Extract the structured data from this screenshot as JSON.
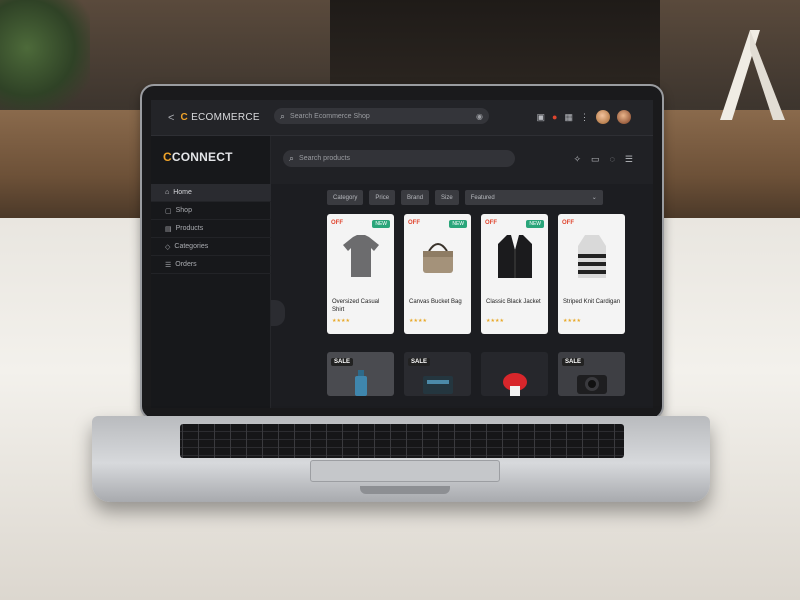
{
  "colors": {
    "accent": "#f0a329",
    "sale_red": "#e0452e",
    "badge_green": "#2aa57a",
    "star": "#e8a92a"
  },
  "topbar": {
    "back_label": "<",
    "logo_letter": "C",
    "logo_text": "ECOMMERCE",
    "search_placeholder": "Search Ecommerce Shop",
    "icons": [
      "calendar-icon",
      "notification-icon",
      "cart-icon",
      "more-icon",
      "avatar",
      "avatar-2"
    ]
  },
  "sidebar": {
    "brand_letter": "C",
    "brand_text": "CONNECT",
    "items": [
      {
        "label": "Home",
        "icon": "home-icon"
      },
      {
        "label": "Shop",
        "icon": "shop-icon"
      },
      {
        "label": "Products",
        "icon": "products-icon"
      },
      {
        "label": "Categories",
        "icon": "categories-icon"
      },
      {
        "label": "Orders",
        "icon": "orders-icon"
      }
    ]
  },
  "secbar": {
    "search_placeholder": "Search products",
    "icons": [
      "sparkle-icon",
      "chat-icon",
      "settings-icon",
      "menu-icon"
    ]
  },
  "filters": {
    "chips": [
      "Category",
      "Price",
      "Brand",
      "Size"
    ],
    "sort_label": "Featured"
  },
  "products": [
    {
      "tag": "OFF",
      "badge": "NEW",
      "name": "Oversized Casual Shirt",
      "rating": "★★★★",
      "icon": "shirt-icon"
    },
    {
      "tag": "OFF",
      "badge": "NEW",
      "name": "Canvas Bucket Bag",
      "rating": "★★★★",
      "icon": "bag-icon"
    },
    {
      "tag": "OFF",
      "badge": "NEW",
      "name": "Classic Black Jacket",
      "rating": "★★★★",
      "icon": "jacket-icon"
    },
    {
      "tag": "OFF",
      "badge": "",
      "name": "Striped Knit Cardigan",
      "rating": "★★★★",
      "icon": "cardigan-icon"
    },
    {
      "tag": "SALE",
      "badge": "",
      "name": "",
      "rating": "",
      "icon": "bottle-icon"
    },
    {
      "tag": "SALE",
      "badge": "",
      "name": "",
      "rating": "",
      "icon": "speaker-icon"
    },
    {
      "tag": "",
      "badge": "",
      "name": "",
      "rating": "",
      "icon": "toy-icon"
    },
    {
      "tag": "SALE",
      "badge": "",
      "name": "",
      "rating": "",
      "icon": "camera-icon"
    }
  ]
}
